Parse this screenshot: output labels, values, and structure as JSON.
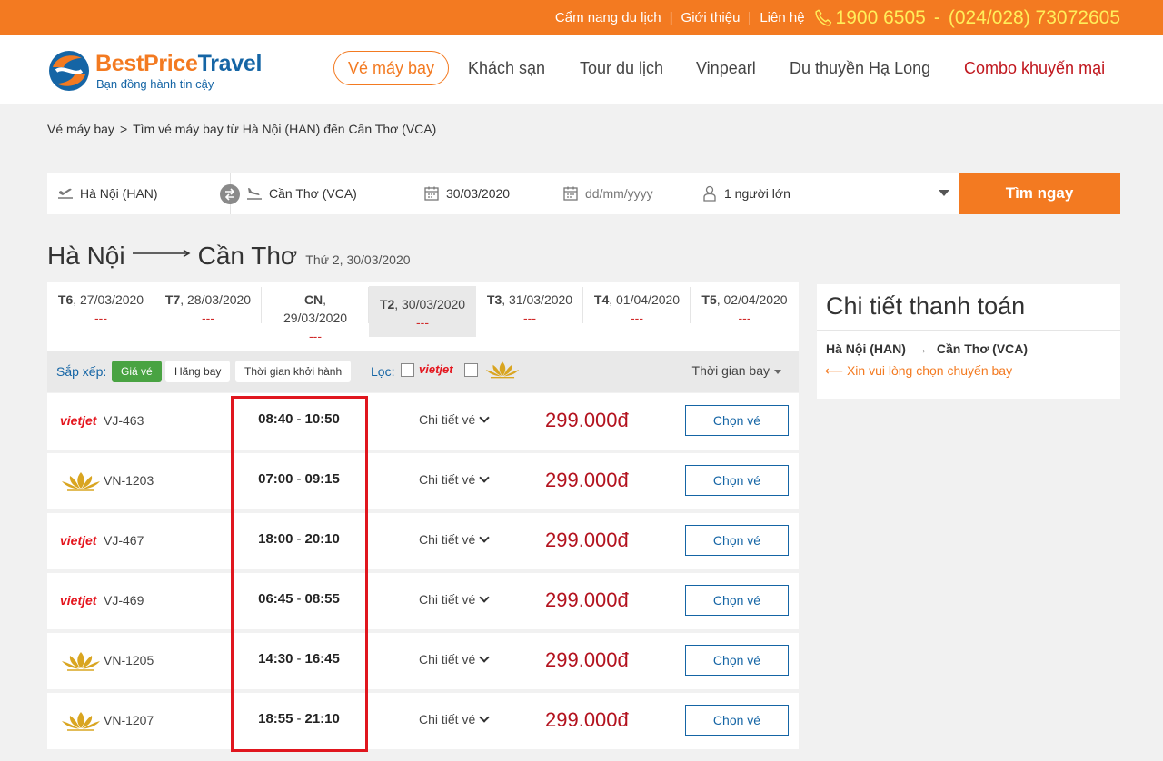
{
  "topbar": {
    "links": [
      "Cẩm nang du lịch",
      "Giới thiệu",
      "Liên hệ"
    ],
    "hotline1": "1900 6505",
    "hotline_sep": "-",
    "hotline2": "(024/028) 73072605"
  },
  "logo": {
    "brand_a": "BestPrice",
    "brand_b": "Travel",
    "tagline": "Bạn đồng hành tin cậy"
  },
  "nav": [
    "Vé máy bay",
    "Khách sạn",
    "Tour du lịch",
    "Vinpearl",
    "Du thuyền Hạ Long",
    "Combo khuyến mại"
  ],
  "breadcrumb": {
    "home": "Vé máy bay",
    "sep": ">",
    "current": "Tìm vé máy bay từ Hà Nội (HAN) đến Cần Thơ (VCA)"
  },
  "search": {
    "from": "Hà Nội (HAN)",
    "to": "Cần Thơ (VCA)",
    "depart": "30/03/2020",
    "return_placeholder": "dd/mm/yyyy",
    "passengers": "1 người lớn",
    "button": "Tìm ngay"
  },
  "route": {
    "from": "Hà Nội",
    "to": "Cần Thơ",
    "date": "Thứ 2, 30/03/2020"
  },
  "date_tabs": [
    {
      "day": "T6",
      "date": ", 27/03/2020",
      "price": "---"
    },
    {
      "day": "T7",
      "date": ", 28/03/2020",
      "price": "---"
    },
    {
      "day": "CN",
      "date": ",",
      "date2": "29/03/2020",
      "price": "---"
    },
    {
      "day": "T2",
      "date": ", 30/03/2020",
      "price": "---"
    },
    {
      "day": "T3",
      "date": ", 31/03/2020",
      "price": "---"
    },
    {
      "day": "T4",
      "date": ", 01/04/2020",
      "price": "---"
    },
    {
      "day": "T5",
      "date": ", 02/04/2020",
      "price": "---"
    }
  ],
  "sortbar": {
    "sort_label": "Sắp xếp:",
    "sort_price": "Giá vé",
    "sort_airline": "Hãng bay",
    "sort_time": "Thời gian khởi hành",
    "filter_label": "Lọc:",
    "vietjet": "vietjet",
    "flight_time": "Thời gian bay"
  },
  "flights": [
    {
      "airline": "vietjet",
      "code": "VJ-463",
      "dep": "08:40",
      "arr": "10:50",
      "detail": "Chi tiết vé",
      "price": "299.000đ",
      "cta": "Chọn vé"
    },
    {
      "airline": "vietnam-airlines",
      "code": "VN-1203",
      "dep": "07:00",
      "arr": "09:15",
      "detail": "Chi tiết vé",
      "price": "299.000đ",
      "cta": "Chọn vé"
    },
    {
      "airline": "vietjet",
      "code": "VJ-467",
      "dep": "18:00",
      "arr": "20:10",
      "detail": "Chi tiết vé",
      "price": "299.000đ",
      "cta": "Chọn vé"
    },
    {
      "airline": "vietjet",
      "code": "VJ-469",
      "dep": "06:45",
      "arr": "08:55",
      "detail": "Chi tiết vé",
      "price": "299.000đ",
      "cta": "Chọn vé"
    },
    {
      "airline": "vietnam-airlines",
      "code": "VN-1205",
      "dep": "14:30",
      "arr": "16:45",
      "detail": "Chi tiết vé",
      "price": "299.000đ",
      "cta": "Chọn vé"
    },
    {
      "airline": "vietnam-airlines",
      "code": "VN-1207",
      "dep": "18:55",
      "arr": "21:10",
      "detail": "Chi tiết vé",
      "price": "299.000đ",
      "cta": "Chọn vé"
    }
  ],
  "payment": {
    "title": "Chi tiết thanh toán",
    "from": "Hà Nội (HAN)",
    "arrow": "→",
    "to": "Cần Thơ (VCA)",
    "note": "⟵ Xin vui lòng chọn chuyến bay"
  },
  "colors": {
    "brand_orange": "#f37a21",
    "brand_blue": "#1565a5",
    "price_red": "#b3121e",
    "highlight_red": "#e0161e",
    "sort_green": "#49a342"
  }
}
